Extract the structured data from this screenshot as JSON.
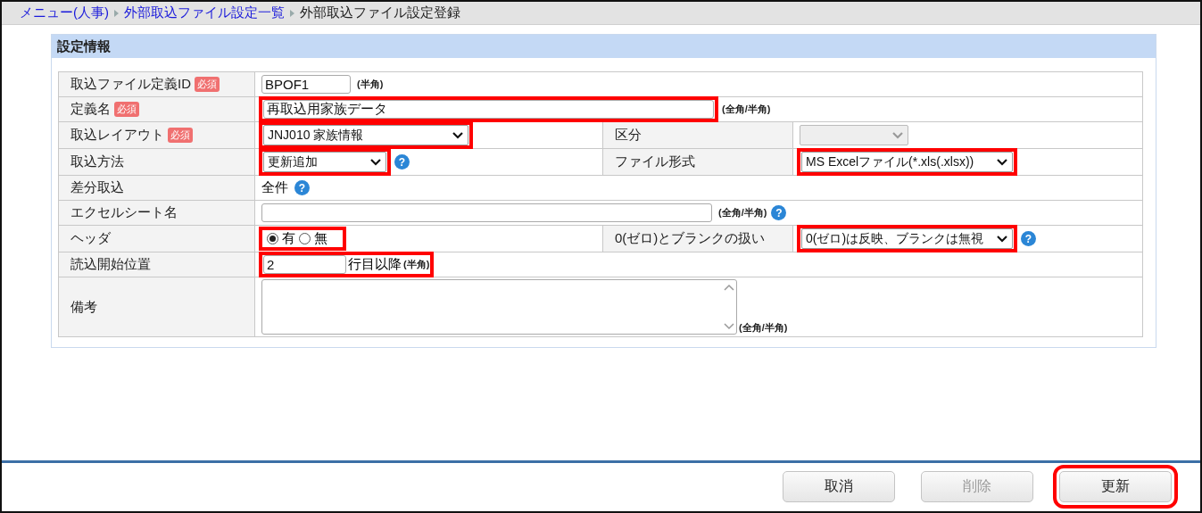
{
  "breadcrumb": [
    {
      "label": "メニュー(人事)",
      "kind": "link"
    },
    {
      "label": "外部取込ファイル設定一覧",
      "kind": "link"
    },
    {
      "label": "外部取込ファイル設定登録",
      "kind": "current"
    }
  ],
  "section": {
    "title": "設定情報"
  },
  "rows": [
    {
      "items": [
        {
          "label": "取込ファイル定義ID",
          "required": "必須",
          "kind": "text",
          "value": "BPOF1",
          "note": "(半角)",
          "highlighted": false
        }
      ]
    },
    {
      "items": [
        {
          "label": "定義名",
          "required": "必須",
          "kind": "text",
          "value": "再取込用家族データ",
          "note": "(全角/半角)",
          "highlighted": true
        }
      ]
    },
    {
      "items": [
        {
          "label": "取込レイアウト",
          "required": "必須",
          "kind": "select",
          "value": "JNJ010 家族情報",
          "disabled": false,
          "highlighted": true
        },
        {
          "label": "区分",
          "kind": "select",
          "disabled": true,
          "highlighted": false
        }
      ]
    },
    {
      "items": [
        {
          "label": "取込方法",
          "kind": "select",
          "value": "更新追加",
          "disabled": false,
          "highlighted": true,
          "help": "?"
        },
        {
          "label": "ファイル形式",
          "kind": "select",
          "value": "MS Excelファイル(*.xls(.xlsx))",
          "disabled": false,
          "highlighted": true
        }
      ]
    },
    {
      "items": [
        {
          "label": "差分取込",
          "kind": "static",
          "value": "全件",
          "help": "?",
          "highlighted": false
        }
      ]
    },
    {
      "items": [
        {
          "label": "エクセルシート名",
          "kind": "text",
          "note": "(全角/半角)",
          "help": "?",
          "highlighted": false
        }
      ]
    },
    {
      "items": [
        {
          "label": "ヘッダ",
          "kind": "radio",
          "options": [
            {
              "label": "有",
              "selected": true
            },
            {
              "label": "無",
              "selected": false
            }
          ],
          "highlighted": true
        },
        {
          "label": "0(ゼロ)とブランクの扱い",
          "kind": "select",
          "value": "0(ゼロ)は反映、ブランクは無視",
          "disabled": false,
          "highlighted": true,
          "help": "?"
        }
      ]
    },
    {
      "items": [
        {
          "label": "読込開始位置",
          "kind": "text",
          "value": "2",
          "suffix": "行目以降",
          "note": "(半角)",
          "highlighted": true
        }
      ]
    },
    {
      "items": [
        {
          "label": "備考",
          "kind": "textarea",
          "note": "(全角/半角)",
          "highlighted": false
        }
      ]
    }
  ],
  "buttons": [
    {
      "label": "取消",
      "disabled": false,
      "highlighted": false
    },
    {
      "label": "削除",
      "disabled": true,
      "highlighted": false
    },
    {
      "label": "更新",
      "disabled": false,
      "highlighted": true
    }
  ]
}
